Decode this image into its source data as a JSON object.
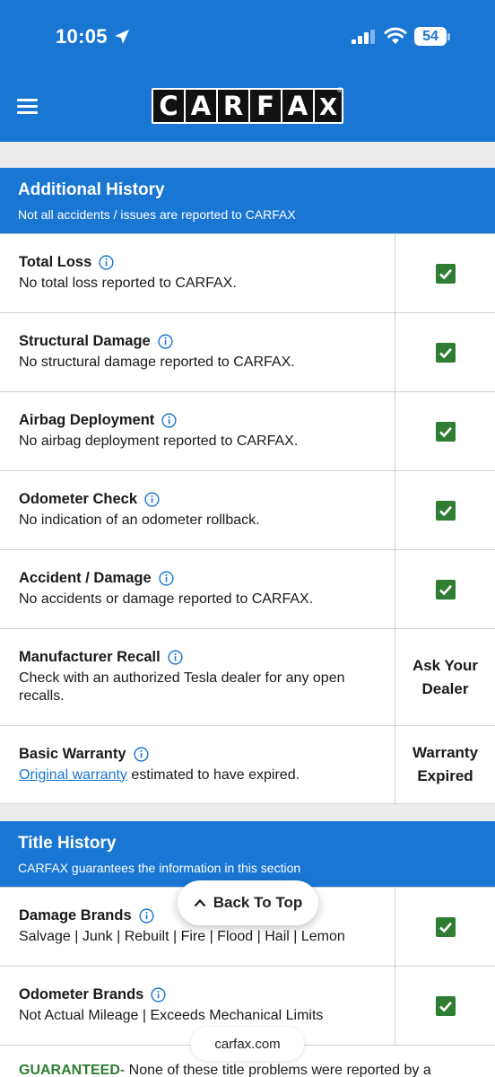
{
  "status_bar": {
    "time": "10:05",
    "battery": "54"
  },
  "header": {
    "logo_letters": [
      "C",
      "A",
      "R",
      "F",
      "A",
      "X"
    ],
    "registered": "®"
  },
  "additional_history": {
    "title": "Additional History",
    "subtitle": "Not all accidents / issues are reported to CARFAX",
    "rows": [
      {
        "title": "Total Loss",
        "desc": "No total loss reported to CARFAX."
      },
      {
        "title": "Structural Damage",
        "desc": "No structural damage reported to CARFAX."
      },
      {
        "title": "Airbag Deployment",
        "desc": "No airbag deployment reported to CARFAX."
      },
      {
        "title": "Odometer Check",
        "desc": "No indication of an odometer rollback."
      },
      {
        "title": "Accident / Damage",
        "desc": "No accidents or damage reported to CARFAX."
      },
      {
        "title": "Manufacturer Recall",
        "desc": "Check with an authorized Tesla dealer for any open recalls.",
        "status_line1": "Ask Your",
        "status_line2": "Dealer"
      },
      {
        "title": "Basic Warranty",
        "desc_link": "Original warranty",
        "desc_rest": " estimated to have expired.",
        "status_line1": "Warranty",
        "status_line2": "Expired"
      }
    ]
  },
  "title_history": {
    "title": "Title History",
    "subtitle": "CARFAX guarantees the information in this section",
    "rows": [
      {
        "title": "Damage Brands",
        "desc": "Salvage | Junk | Rebuilt | Fire | Flood | Hail | Lemon"
      },
      {
        "title": "Odometer Brands",
        "desc": "Not Actual Mileage | Exceeds Mechanical Limits"
      }
    ],
    "guaranteed_label": "GUARANTEED",
    "guaranteed_text": " - None of these title problems were reported by a"
  },
  "back_to_top": "Back To Top",
  "url": "carfax.com",
  "colors": {
    "brand_blue": "#1976d2",
    "check_green": "#2e7d32"
  }
}
